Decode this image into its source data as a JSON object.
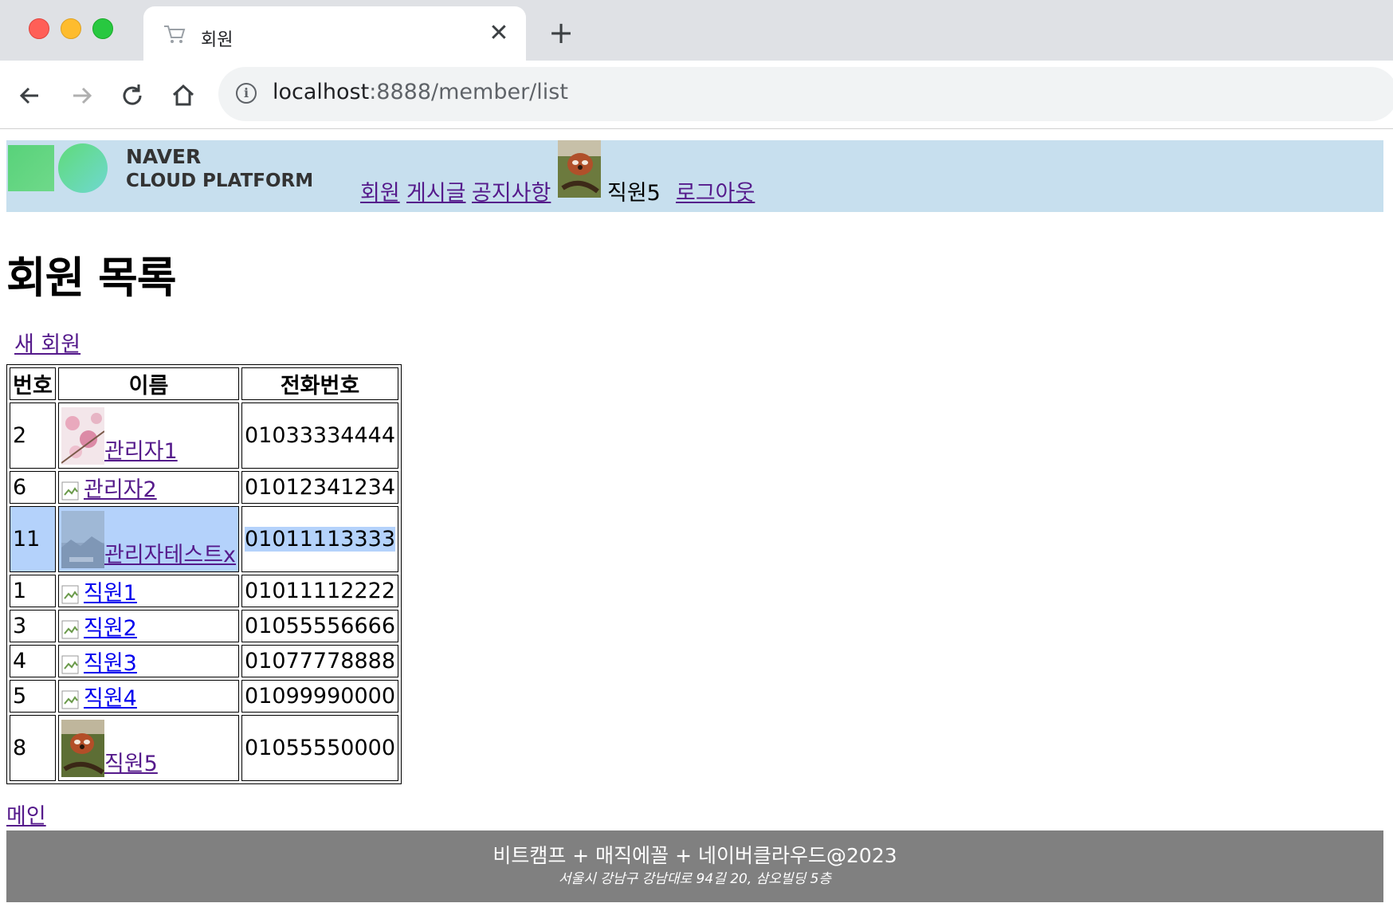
{
  "browser": {
    "tab_title": "회원",
    "new_tab_symbol": "+",
    "close_symbol": "✕",
    "url_host": "localhost",
    "url_rest": ":8888/member/list"
  },
  "header": {
    "logo_line1": "NAVER",
    "logo_line2": "CLOUD PLATFORM",
    "nav": [
      "회원",
      "게시글",
      "공지사항"
    ],
    "user_name": "직원5",
    "logout": "로그아웃"
  },
  "page_title": "회원 목록",
  "new_member_link": "새 회원",
  "table": {
    "headers": [
      "번호",
      "이름",
      "전화번호"
    ],
    "rows": [
      {
        "no": "2",
        "name": "관리자1",
        "phone": "01033334444",
        "photo": "cherry-blossom"
      },
      {
        "no": "6",
        "name": "관리자2",
        "phone": "01012341234",
        "photo": "broken"
      },
      {
        "no": "11",
        "name": "관리자테스트x",
        "phone": "01011113333",
        "photo": "landscape"
      },
      {
        "no": "1",
        "name": "직원1",
        "phone": "01011112222",
        "photo": "broken"
      },
      {
        "no": "3",
        "name": "직원2",
        "phone": "01055556666",
        "photo": "broken"
      },
      {
        "no": "4",
        "name": "직원3",
        "phone": "01077778888",
        "photo": "broken"
      },
      {
        "no": "5",
        "name": "직원4",
        "phone": "01099990000",
        "photo": "broken"
      },
      {
        "no": "8",
        "name": "직원5",
        "phone": "01055550000",
        "photo": "red-panda"
      }
    ]
  },
  "main_link": "메인",
  "footer": {
    "line1": "비트캠프 + 매직에꼴 + 네이버클라우드@2023",
    "line2": "서울시 강남구 강남대로 94길 20, 삼오빌딩 5층"
  },
  "colors": {
    "header_bg": "#c7dfee",
    "footer_bg": "#808080",
    "visited_link": "#551a8b",
    "link": "#0000ee",
    "selection": "#b4d2fb"
  }
}
